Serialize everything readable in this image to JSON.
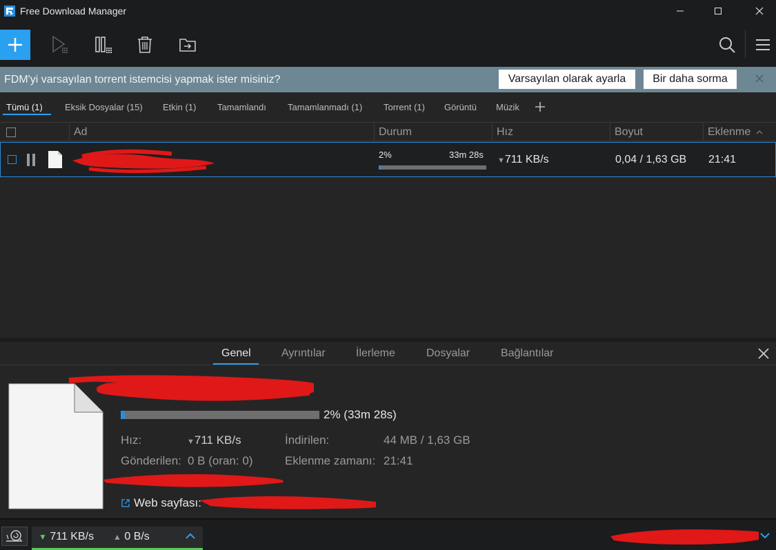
{
  "window": {
    "title": "Free Download Manager"
  },
  "banner": {
    "text": "FDM'yi varsayılan torrent istemcisi yapmak ister misiniz?",
    "set_default_label": "Varsayılan olarak ayarla",
    "dont_ask_label": "Bir daha sorma"
  },
  "filters": [
    {
      "label": "Tümü (1)",
      "active": true
    },
    {
      "label": "Eksik Dosyalar (15)"
    },
    {
      "label": "Etkin (1)"
    },
    {
      "label": "Tamamlandı"
    },
    {
      "label": "Tamamlanmadı (1)"
    },
    {
      "label": "Torrent (1)"
    },
    {
      "label": "Görüntü"
    },
    {
      "label": "Müzik"
    }
  ],
  "columns": {
    "name": "Ad",
    "status": "Durum",
    "speed": "Hız",
    "size": "Boyut",
    "added": "Eklenme"
  },
  "download": {
    "percent_label": "2%",
    "eta": "33m 28s",
    "progress": 0.02,
    "speed": "711 KB/s",
    "size": "0,04 / 1,63 GB",
    "added": "21:41"
  },
  "details": {
    "tabs": [
      "Genel",
      "Ayrıntılar",
      "İlerleme",
      "Dosyalar",
      "Bağlantılar"
    ],
    "progress_text": "2% (33m 28s)",
    "speed_label": "Hız:",
    "speed_value": "711 KB/s",
    "sent_label": "Gönderilen:",
    "sent_value": "0 B (oran: 0)",
    "downloaded_label": "İndirilen:",
    "downloaded_value": "44 MB / 1,63 GB",
    "added_time_label": "Eklenme zamanı:",
    "added_time_value": "21:41",
    "web_page_label": "Web sayfası:"
  },
  "statusbar": {
    "down_speed": "711 KB/s",
    "up_speed": "0 B/s"
  },
  "colors": {
    "accent": "#2aa0f0",
    "banner": "#6e8794",
    "redaction": "#e01818"
  }
}
